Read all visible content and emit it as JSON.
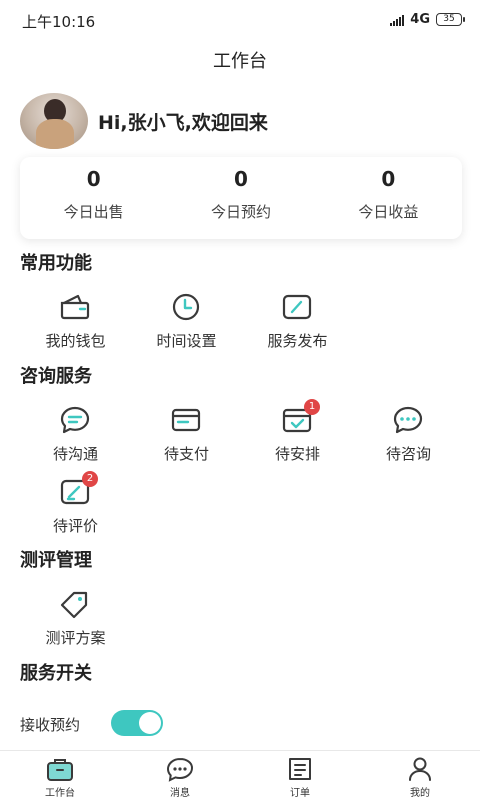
{
  "status_bar": {
    "time": "上午10:16",
    "network": "4G",
    "battery": "35"
  },
  "header": {
    "title": "工作台"
  },
  "user": {
    "greeting": "Hi,张小飞,欢迎回来"
  },
  "stats": [
    {
      "value": "0",
      "label": "今日出售"
    },
    {
      "value": "0",
      "label": "今日预约"
    },
    {
      "value": "0",
      "label": "今日收益"
    }
  ],
  "sections": {
    "common": {
      "title": "常用功能",
      "items": [
        {
          "label": "我的钱包",
          "icon": "wallet-icon"
        },
        {
          "label": "时间设置",
          "icon": "clock-icon"
        },
        {
          "label": "服务发布",
          "icon": "edit-icon"
        }
      ]
    },
    "consult": {
      "title": "咨询服务",
      "items": [
        {
          "label": "待沟通",
          "icon": "chat-icon"
        },
        {
          "label": "待支付",
          "icon": "card-icon"
        },
        {
          "label": "待安排",
          "icon": "calendar-check-icon",
          "badge": "1"
        },
        {
          "label": "待咨询",
          "icon": "message-dots-icon"
        },
        {
          "label": "待评价",
          "icon": "review-icon",
          "badge": "2"
        }
      ]
    },
    "assessment": {
      "title": "测评管理",
      "items": [
        {
          "label": "测评方案",
          "icon": "tag-icon"
        }
      ]
    },
    "service_switch": {
      "title": "服务开关",
      "label": "接收预约",
      "enabled": true
    }
  },
  "tabbar": [
    {
      "label": "工作台",
      "icon": "briefcase-icon",
      "active": true
    },
    {
      "label": "消息",
      "icon": "message-icon"
    },
    {
      "label": "订单",
      "icon": "order-icon"
    },
    {
      "label": "我的",
      "icon": "user-icon"
    }
  ],
  "colors": {
    "accent": "#3ec7c0",
    "badge": "#e04646",
    "icon_stroke": "#3a3a3a"
  }
}
